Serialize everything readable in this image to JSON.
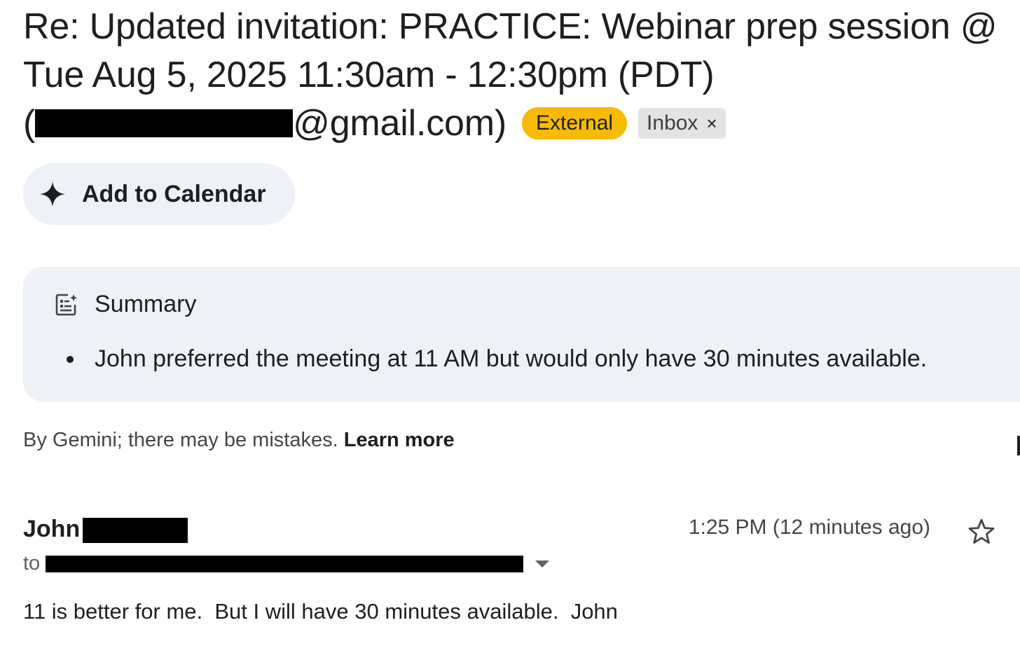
{
  "email": {
    "subject_line1": "Re: Updated invitation: PRACTICE: Webinar prep session @",
    "subject_line2": "Tue Aug 5, 2025 11:30am - 12:30pm (PDT)",
    "subject_line3_open": "(",
    "subject_line3_email_suffix": "@gmail.com)",
    "labels": {
      "external": "External",
      "inbox": "Inbox",
      "inbox_remove": "×"
    },
    "add_to_calendar": "Add to Calendar",
    "summary": {
      "title": "Summary",
      "items": [
        "John preferred the meeting at 11 AM but would only have 30 minutes available."
      ]
    },
    "disclaimer": {
      "text": "By Gemini; there may be mistakes.",
      "learn_more": "Learn more"
    },
    "message": {
      "sender_first": "John",
      "time": "1:25 PM (12 minutes ago)",
      "to_label": "to",
      "body": "11 is better for me.  But I will have 30 minutes available.  John"
    }
  },
  "colors": {
    "external_chip": "#f6bb05",
    "inbox_chip": "#e3e3e3",
    "card_background": "#eef1f6"
  },
  "icons": {
    "calendar_button": "sparkle-icon",
    "summary": "summary-doc-sparkle-icon",
    "star": "star-outline-icon",
    "recipients": "caret-down-icon"
  }
}
